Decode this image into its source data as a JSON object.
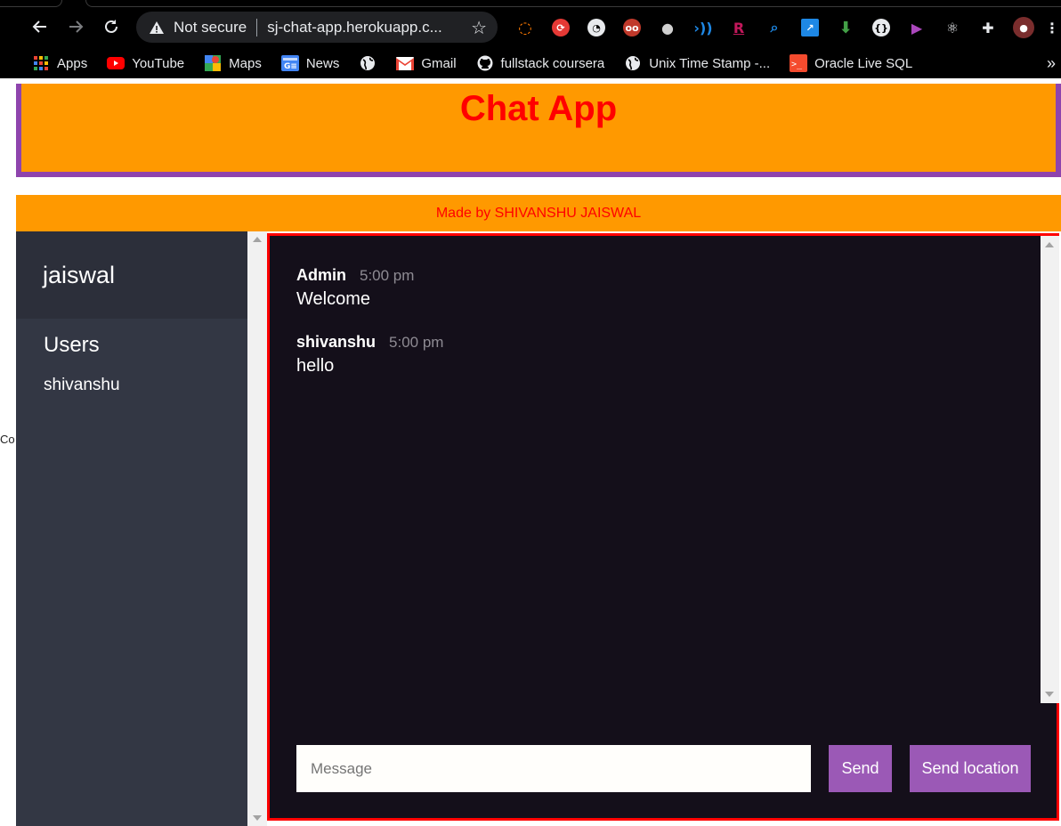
{
  "browser": {
    "nav": {
      "back_icon": "arrow-left-icon",
      "forward_icon": "arrow-right-icon",
      "reload_icon": "reload-icon"
    },
    "omnibox": {
      "security_icon": "warning-triangle-icon",
      "security_label": "Not secure",
      "url": "sj-chat-app.herokuapp.c...",
      "bookmark_icon": "star-icon"
    },
    "extensions": [
      "ext-1",
      "ext-2",
      "ext-3",
      "ext-4",
      "ext-5",
      "ext-6",
      "ext-7",
      "ext-8",
      "ext-9",
      "ext-10",
      "ext-11",
      "ext-12",
      "ext-13",
      "puzzle",
      "profile",
      "menu"
    ],
    "bookmarks": [
      {
        "label": "Apps",
        "icon": "apps-grid-icon"
      },
      {
        "label": "YouTube",
        "icon": "youtube-icon"
      },
      {
        "label": "Maps",
        "icon": "maps-icon"
      },
      {
        "label": "News",
        "icon": "news-icon"
      },
      {
        "label": "",
        "icon": "globe-icon"
      },
      {
        "label": "Gmail",
        "icon": "gmail-icon"
      },
      {
        "label": "fullstack coursera",
        "icon": "github-icon"
      },
      {
        "label": "Unix Time Stamp -...",
        "icon": "globe-icon"
      },
      {
        "label": "Oracle Live SQL",
        "icon": "oracle-icon"
      }
    ],
    "bookmarks_overflow": "»"
  },
  "page": {
    "cut_text": "Co",
    "header_title": "Chat App",
    "credit": "Made by SHIVANSHU JAISWAL",
    "sidebar": {
      "room": "jaiswal",
      "users_heading": "Users",
      "users": [
        "shivanshu"
      ]
    },
    "messages": [
      {
        "author": "Admin",
        "time": "5:00 pm",
        "text": "Welcome"
      },
      {
        "author": "shivanshu",
        "time": "5:00 pm",
        "text": "hello"
      }
    ],
    "composer": {
      "placeholder": "Message",
      "send_label": "Send",
      "location_label": "Send location"
    }
  },
  "colors": {
    "header_bg": "#ff9900",
    "header_border": "#8e44ad",
    "title_red": "#ff0000",
    "sidebar_bg": "#333744",
    "chat_bg": "#140f1a",
    "button_purple": "#9b59b6"
  }
}
